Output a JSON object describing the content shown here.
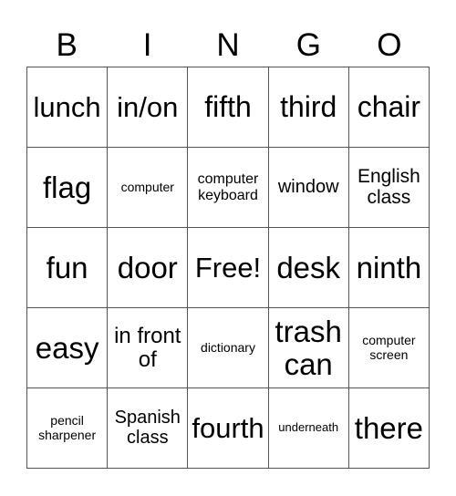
{
  "header": [
    "B",
    "I",
    "N",
    "G",
    "O"
  ],
  "cells": [
    [
      "lunch",
      "in/on",
      "fifth",
      "third",
      "chair"
    ],
    [
      "flag",
      "computer",
      "computer keyboard",
      "window",
      "English class"
    ],
    [
      "fun",
      "door",
      "Free!",
      "desk",
      "ninth"
    ],
    [
      "easy",
      "in front of",
      "dictionary",
      "trash can",
      "computer screen"
    ],
    [
      "pencil sharpener",
      "Spanish class",
      "fourth",
      "underneath",
      "there"
    ]
  ]
}
